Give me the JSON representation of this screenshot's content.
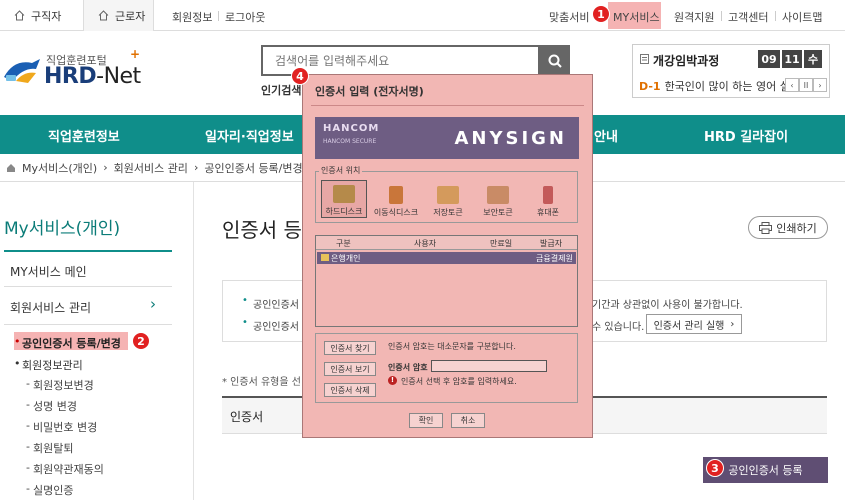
{
  "topbar": {
    "tab_jobseeker": "구직자",
    "tab_worker": "근로자",
    "member_info": "회원정보",
    "logout": "로그아웃",
    "custom_service": "맞춤서비",
    "my_service": "MY서비스",
    "remote_support": "원격지원",
    "customer_center": "고객센터",
    "sitemap": "사이트맵"
  },
  "header": {
    "logo_sub": "직업훈련포털",
    "logo_main_a": "HRD",
    "logo_main_b": "-Net",
    "search_placeholder": "검색어를 입력해주세요",
    "popular_label": "인기검색"
  },
  "course": {
    "title": "개강임박과정",
    "month": "09",
    "day": "11",
    "weekday": "수",
    "dday": "D-1",
    "course_text": "한국인이 많이 하는 영어 실..."
  },
  "nav": {
    "items": [
      "직업훈련정보",
      "일자리·직업정보",
      "안내",
      "HRD 길라잡이"
    ]
  },
  "breadcrumb": {
    "items": [
      "My서비스(개인)",
      "회원서비스 관리",
      "공인인증서 등록/변경"
    ]
  },
  "sidebar": {
    "title": "My서비스(개인)",
    "main": "MY서비스 메인",
    "member_mgmt": "회원서비스 관리",
    "cert_reg": "공인인증서 등록/변경",
    "member_info_mgmt": "회원정보관리",
    "subs": [
      "회원정보변경",
      "성명 변경",
      "비밀번호 변경",
      "회원탈퇴",
      "회원약관재동의",
      "실명인증"
    ]
  },
  "content": {
    "title": "인증서 등",
    "print": "인쇄하기",
    "info1a": "공인인증서",
    "info1b": "기간과 상관없이 사용이 불가합니다.",
    "info2a": "공인인증서",
    "info2b": "수 있습니다.",
    "cert_mgr_btn": "인증서 관리 실행",
    "note": "* 인증서 유형을 선",
    "table_head": "인증서",
    "register_btn": "공인인증서 등록"
  },
  "markers": [
    "1",
    "2",
    "3",
    "4"
  ],
  "dialog": {
    "title": "인증서 입력 (전자서명)",
    "brand_top": "HANCOM",
    "brand_bottom": "HANCOM SECURE",
    "product": "ANYSIGN",
    "location_label": "인증서 위치",
    "locations": [
      "하드디스크",
      "이동식디스크",
      "저장토큰",
      "보안토큰",
      "휴대폰"
    ],
    "col_type": "구분",
    "col_user": "사용자",
    "col_expiry": "만료일",
    "col_issuer": "발급자",
    "row_type": "은행개인",
    "row_issuer": "금융결제원",
    "btn_find": "인증서 찾기",
    "btn_view": "인증서 보기",
    "btn_delete": "인증서 삭제",
    "case_note": "인증서 암호는 대소문자를 구분합니다.",
    "pw_label": "인증서 암호",
    "warn_text": "인증서 선택 후 암호를 입력하세요.",
    "ok": "확인",
    "cancel": "취소"
  },
  "colors": {
    "nav_teal": "#0f8e8a",
    "marker_red": "#e12121",
    "dialog_pink": "#f2b7b4",
    "banner_purple": "#6e5d83",
    "register_purple": "#5f4e73"
  }
}
